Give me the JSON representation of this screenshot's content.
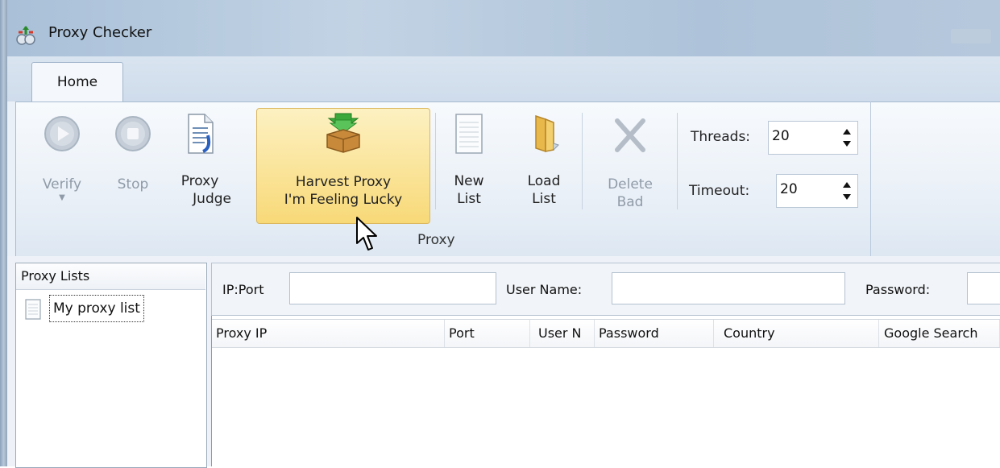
{
  "window": {
    "title": "Proxy Checker"
  },
  "tabs": [
    {
      "label": "Home"
    }
  ],
  "ribbon": {
    "group_label": "Proxy",
    "verify": {
      "line1": "Verify",
      "enabled": false
    },
    "stop": {
      "line1": "Stop",
      "enabled": false
    },
    "proxy_judge": {
      "line1": "Proxy",
      "line2": "Judge",
      "enabled": true
    },
    "harvest": {
      "line1": "Harvest Proxy",
      "line2": "I'm Feeling Lucky",
      "enabled": true
    },
    "new_list": {
      "line1": "New",
      "line2": "List",
      "enabled": true
    },
    "load_list": {
      "line1": "Load",
      "line2": "List",
      "enabled": true
    },
    "delete_bad": {
      "line1": "Delete",
      "line2": "Bad",
      "enabled": false
    },
    "threads": {
      "label": "Threads:",
      "value": "20"
    },
    "timeout": {
      "label": "Timeout:",
      "value": "20"
    }
  },
  "proxy_lists": {
    "header": "Proxy Lists",
    "items": [
      {
        "label": "My proxy list"
      }
    ]
  },
  "filter": {
    "ip_port_label": "IP:Port",
    "ip_port_value": "",
    "user_name_label": "User Name:",
    "user_name_value": "",
    "password_label": "Password:",
    "password_value": ""
  },
  "grid": {
    "columns": [
      "Proxy IP",
      "Port",
      "User N",
      "Password",
      "Country",
      "Google Search"
    ],
    "rows": []
  },
  "colors": {
    "ribbon_highlight": "#f8d978",
    "disabled_icon": "#b7c3cf",
    "accent_blue": "#2f78c4"
  }
}
